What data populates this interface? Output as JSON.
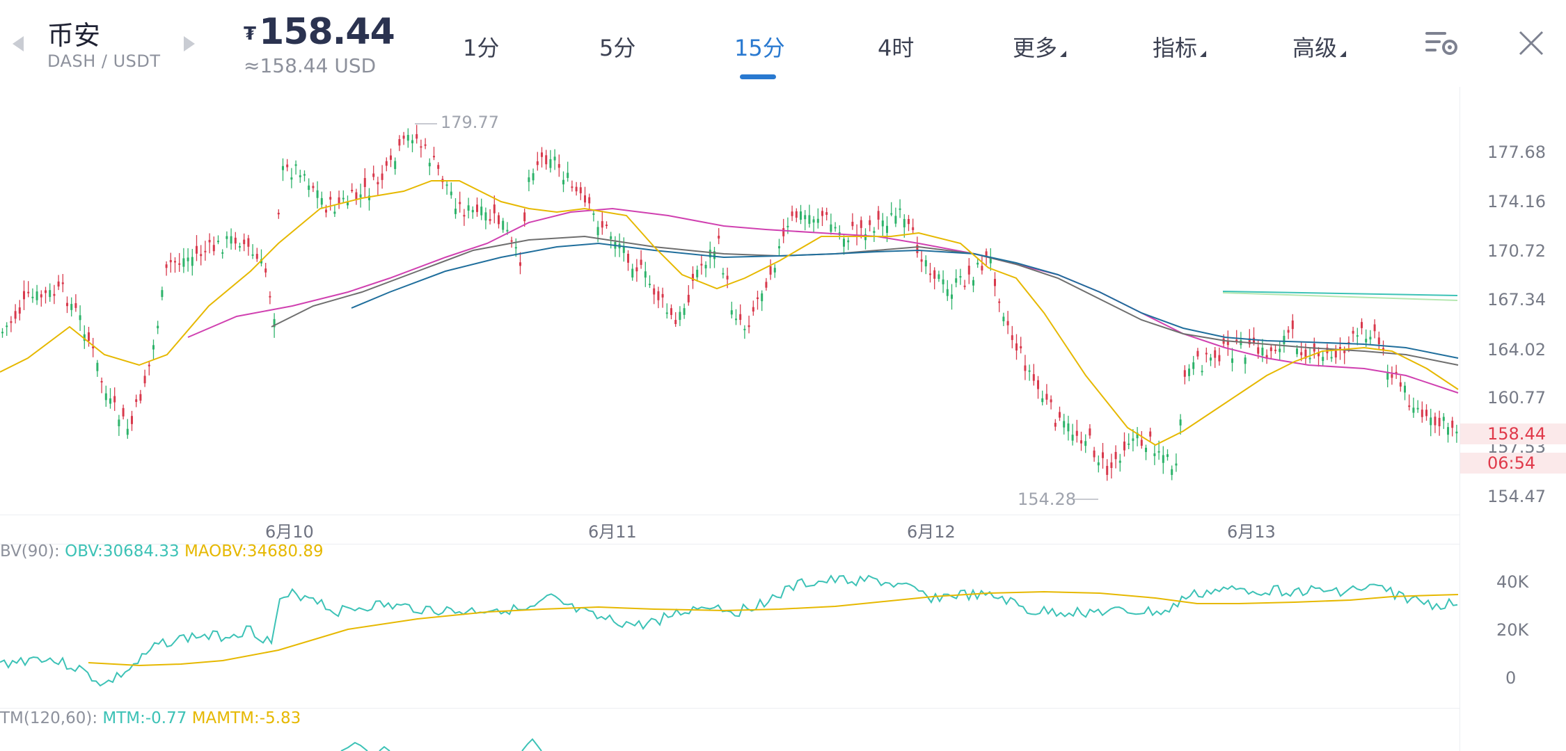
{
  "header": {
    "exchange": "币安",
    "pair": "DASH / USDT",
    "currency_symbol": "₮",
    "price": "158.44",
    "usd_price": "≈158.44 USD",
    "tabs": [
      {
        "label": "1分",
        "active": false
      },
      {
        "label": "5分",
        "active": false
      },
      {
        "label": "15分",
        "active": true
      },
      {
        "label": "4时",
        "active": false
      },
      {
        "label": "更多",
        "active": false,
        "dropdown": true
      },
      {
        "label": "指标",
        "active": false,
        "dropdown": true
      },
      {
        "label": "高级",
        "active": false,
        "dropdown": true
      }
    ],
    "icons": [
      "chevron-left-icon",
      "chevron-right-icon",
      "chart-settings-icon",
      "close-icon"
    ],
    "accent_color": "#2979d0"
  },
  "main_chart": {
    "y_labels": [
      "177.68",
      "174.16",
      "170.72",
      "167.34",
      "164.02",
      "160.77",
      "157.53",
      "154.47"
    ],
    "x_labels": [
      "6月10",
      "6月11",
      "6月12",
      "6月13"
    ],
    "high_marker": "179.77",
    "low_marker": "154.28",
    "current_price_tag": "158.44",
    "countdown_tag": "06:54",
    "up_color": "#2db36a",
    "down_color": "#d8394c"
  },
  "obv": {
    "label_prefix": "BV(90):",
    "obv_label": "OBV:30684.33",
    "maobv_label": "MAOBV:34680.89",
    "y_labels": [
      "40K",
      "20K",
      "0"
    ]
  },
  "mtm": {
    "label_prefix": "TM(120,60):",
    "mtm_label": "MTM:-0.77",
    "mamtm_label": "MAMTM:-5.83"
  }
}
